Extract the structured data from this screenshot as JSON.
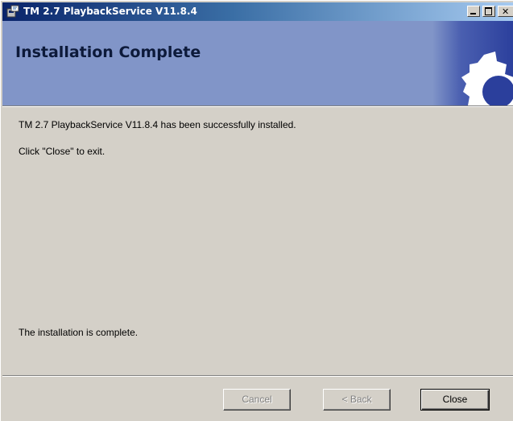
{
  "window": {
    "title": "TM 2.7 PlaybackService V11.8.4",
    "controls": [
      "minimize-icon",
      "maximize-icon",
      "close-icon"
    ]
  },
  "banner": {
    "title": "Installation Complete"
  },
  "body": {
    "message_installed": "TM 2.7 PlaybackService V11.8.4 has been successfully installed.",
    "message_exit": "Click \"Close\" to exit.",
    "message_complete": "The installation is complete."
  },
  "buttons": {
    "cancel_label": "Cancel",
    "back_label": "< Back",
    "close_label": "Close"
  },
  "colors": {
    "titlebar_start": "#0a246a",
    "banner": "#8195c8",
    "dialog": "#d4d0c8"
  }
}
